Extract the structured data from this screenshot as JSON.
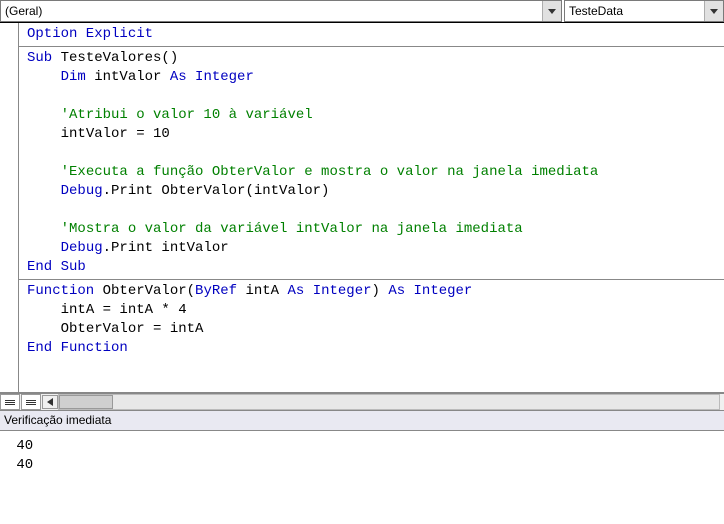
{
  "dropdowns": {
    "object": "(Geral)",
    "procedure": "TesteData"
  },
  "code": {
    "section1": {
      "l1": {
        "kw": "Option Explicit"
      }
    },
    "section2": {
      "l1a": "Sub",
      "l1b": " TesteValores()",
      "l2a": "Dim",
      "l2b": " intValor ",
      "l2c": "As Integer",
      "l3": "'Atribui o valor 10 à variável",
      "l4": "intValor = 10",
      "l5": "'Executa a função ObterValor e mostra o valor na janela imediata",
      "l6a": "Debug",
      "l6b": ".Print ObterValor(intValor)",
      "l7": "'Mostra o valor da variável intValor na janela imediata",
      "l8a": "Debug",
      "l8b": ".Print intValor",
      "l9": "End Sub"
    },
    "section3": {
      "l1a": "Function",
      "l1b": " ObterValor(",
      "l1c": "ByRef",
      "l1d": " intA ",
      "l1e": "As Integer",
      "l1f": ") ",
      "l1g": "As Integer",
      "l2": "intA = intA * 4",
      "l3": "ObterValor = intA",
      "l4": "End Function"
    }
  },
  "immediate": {
    "title": "Verificação imediata",
    "lines": [
      " 40",
      " 40"
    ]
  }
}
